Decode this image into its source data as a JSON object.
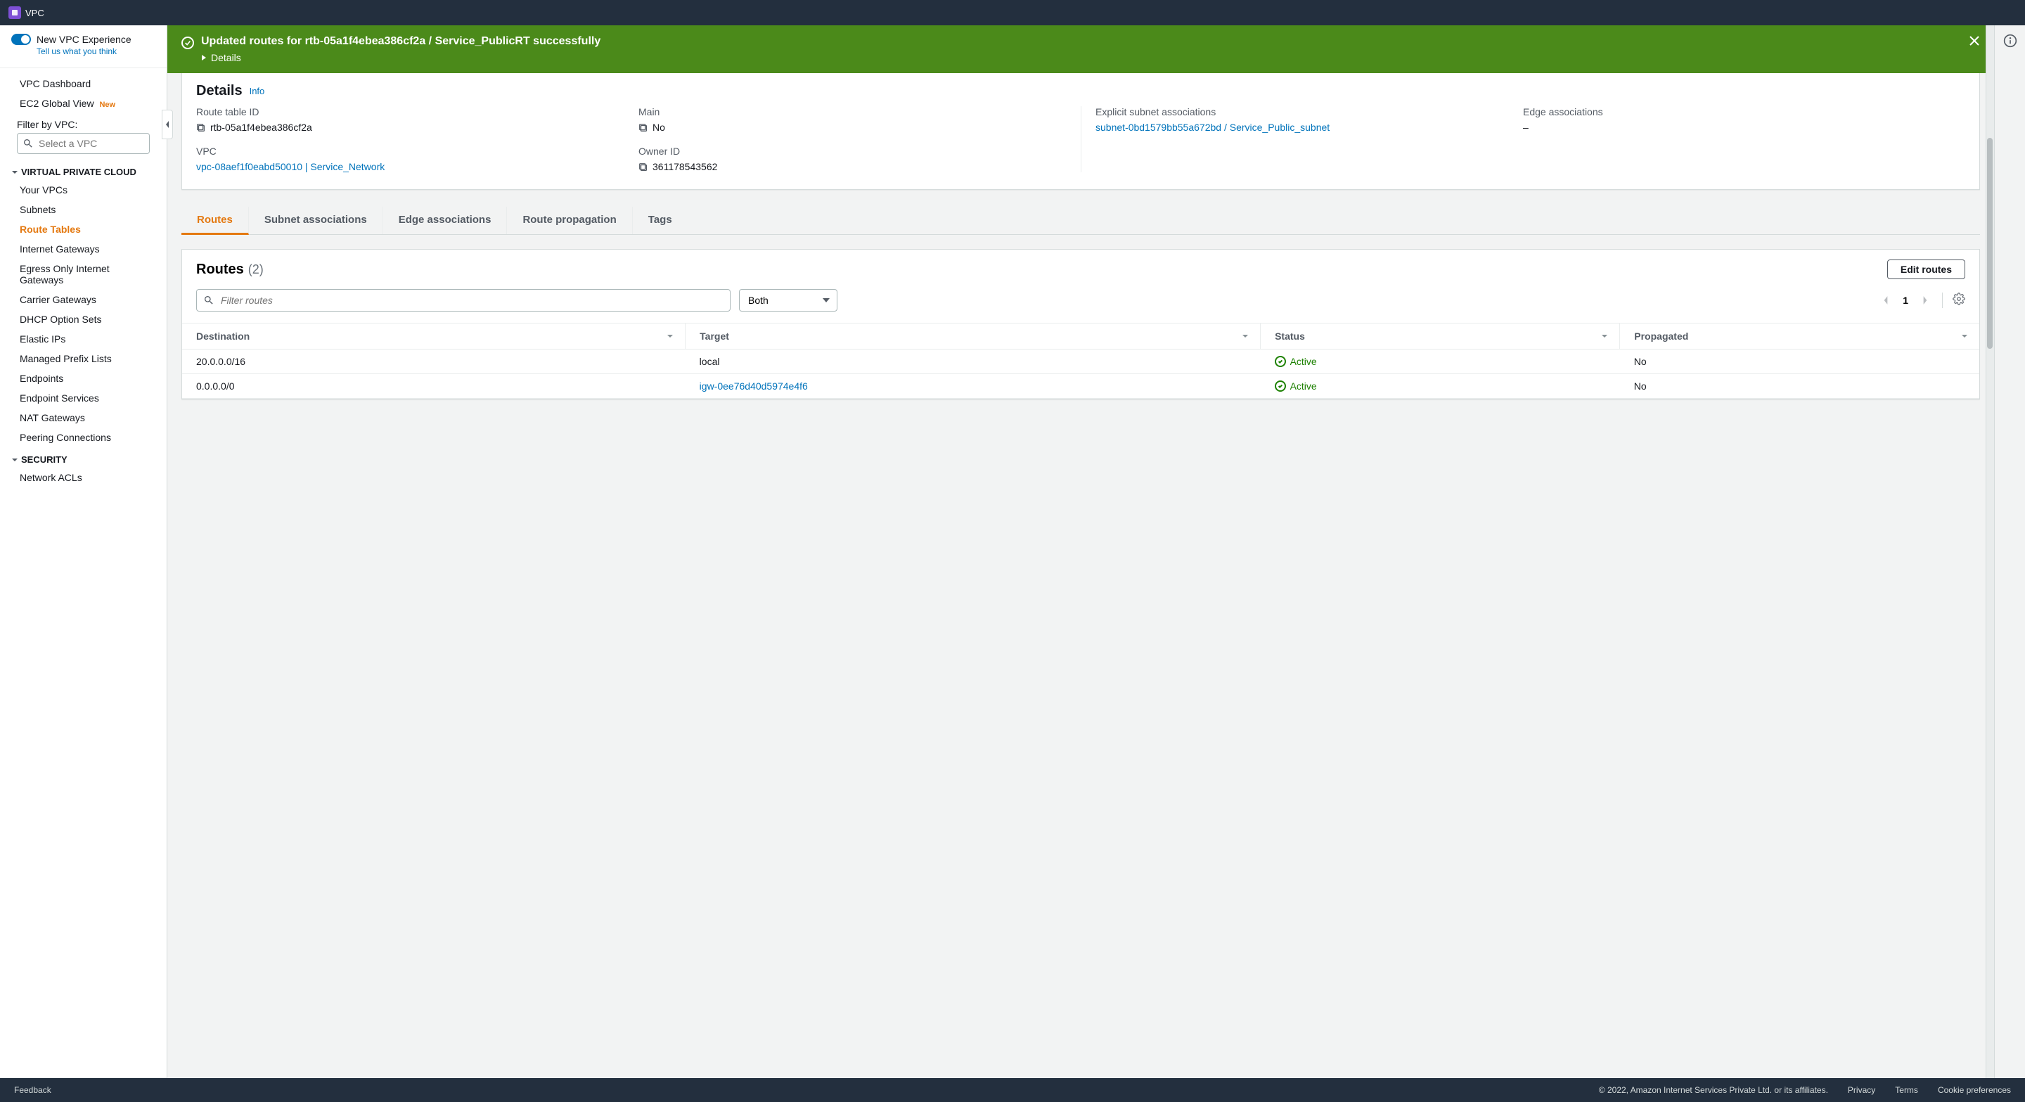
{
  "header": {
    "service_name": "VPC"
  },
  "sidebar": {
    "experience": {
      "title": "New VPC Experience",
      "subtitle": "Tell us what you think"
    },
    "top_items": [
      {
        "label": "VPC Dashboard"
      },
      {
        "label": "EC2 Global View",
        "badge": "New"
      }
    ],
    "filter_label": "Filter by VPC:",
    "filter_placeholder": "Select a VPC",
    "sections": [
      {
        "title": "VIRTUAL PRIVATE CLOUD",
        "items": [
          {
            "label": "Your VPCs"
          },
          {
            "label": "Subnets"
          },
          {
            "label": "Route Tables",
            "active": true
          },
          {
            "label": "Internet Gateways"
          },
          {
            "label": "Egress Only Internet Gateways"
          },
          {
            "label": "Carrier Gateways"
          },
          {
            "label": "DHCP Option Sets"
          },
          {
            "label": "Elastic IPs"
          },
          {
            "label": "Managed Prefix Lists"
          },
          {
            "label": "Endpoints"
          },
          {
            "label": "Endpoint Services"
          },
          {
            "label": "NAT Gateways"
          },
          {
            "label": "Peering Connections"
          }
        ]
      },
      {
        "title": "SECURITY",
        "items": [
          {
            "label": "Network ACLs"
          }
        ]
      }
    ]
  },
  "banner": {
    "title": "Updated routes for rtb-05a1f4ebea386cf2a / Service_PublicRT successfully",
    "details_label": "Details"
  },
  "details": {
    "heading": "Details",
    "info_link": "Info",
    "route_table_id": {
      "label": "Route table ID",
      "value": "rtb-05a1f4ebea386cf2a"
    },
    "main": {
      "label": "Main",
      "value": "No"
    },
    "explicit_subnet": {
      "label": "Explicit subnet associations",
      "value": "subnet-0bd1579bb55a672bd / Service_Public_subnet"
    },
    "edge_assoc": {
      "label": "Edge associations",
      "value": "–"
    },
    "vpc": {
      "label": "VPC",
      "value": "vpc-08aef1f0eabd50010 | Service_Network"
    },
    "owner_id": {
      "label": "Owner ID",
      "value": "361178543562"
    }
  },
  "tabs": [
    {
      "label": "Routes",
      "active": true
    },
    {
      "label": "Subnet associations"
    },
    {
      "label": "Edge associations"
    },
    {
      "label": "Route propagation"
    },
    {
      "label": "Tags"
    }
  ],
  "routes_panel": {
    "title": "Routes",
    "count": "(2)",
    "edit_label": "Edit routes",
    "filter_placeholder": "Filter routes",
    "view_mode": "Both",
    "page": "1",
    "columns": [
      "Destination",
      "Target",
      "Status",
      "Propagated"
    ],
    "rows": [
      {
        "destination": "20.0.0.0/16",
        "target": "local",
        "target_link": false,
        "status": "Active",
        "propagated": "No"
      },
      {
        "destination": "0.0.0.0/0",
        "target": "igw-0ee76d40d5974e4f6",
        "target_link": true,
        "status": "Active",
        "propagated": "No"
      }
    ]
  },
  "footer": {
    "feedback": "Feedback",
    "copyright": "© 2022, Amazon Internet Services Private Ltd. or its affiliates.",
    "links": [
      "Privacy",
      "Terms",
      "Cookie preferences"
    ]
  }
}
